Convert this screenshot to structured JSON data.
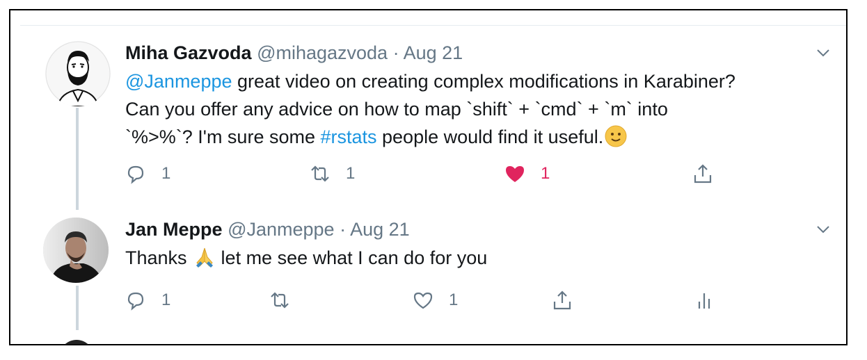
{
  "tweets": [
    {
      "name": "Miha Gazvoda",
      "handle": "@mihagazvoda",
      "separator": "·",
      "date": "Aug 21",
      "text": {
        "mention": "@Janmeppe",
        "line1_rest": " great video on creating complex modifications in Karabiner?",
        "line2": "Can you offer any advice on how to map `shift` + `cmd` + `m` into",
        "line3_pre": "`%>%`? I'm sure some ",
        "hashtag": "#rstats",
        "line3_post": " people would find it useful.",
        "emoji": "slightly-smiling-face"
      },
      "actions": {
        "reply_count": "1",
        "retweet_count": "1",
        "like_count": "1",
        "liked": true
      }
    },
    {
      "name": "Jan Meppe",
      "handle": "@Janmeppe",
      "separator": "·",
      "date": "Aug 21",
      "text": {
        "pre": "Thanks ",
        "emoji": "folded-hands",
        "post": " let me see what I can do for you"
      },
      "actions": {
        "reply_count": "1",
        "retweet_count": "",
        "like_count": "1",
        "liked": false
      }
    }
  ],
  "colors": {
    "text": "#14171a",
    "secondary": "#657786",
    "link": "#1b95e0",
    "like": "#e0245e",
    "thread_line": "#ccd6dd"
  }
}
